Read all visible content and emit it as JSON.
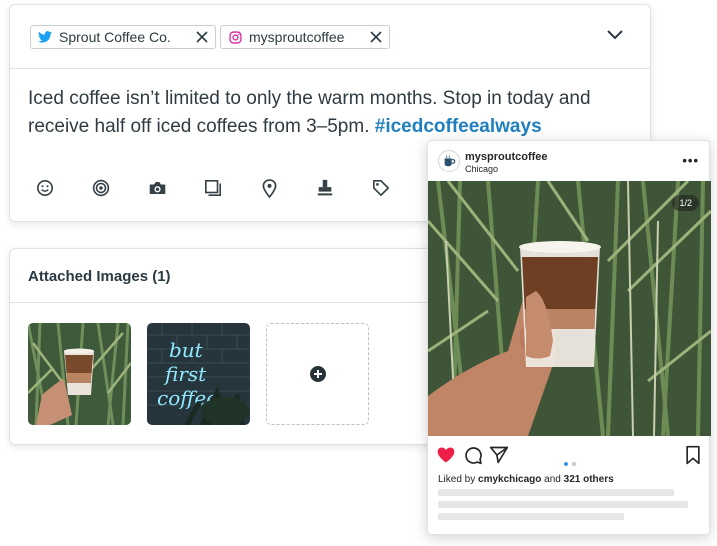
{
  "composer": {
    "profiles": [
      {
        "network": "twitter",
        "name": "Sprout Coffee Co."
      },
      {
        "network": "instagram",
        "name": "mysproutcoffee"
      }
    ],
    "message_text": "Iced coffee isn’t limited to only the warm months. Stop in today and receive half off iced coffees from 3–5pm. ",
    "hashtag": "#icedcoffeealways",
    "tools": [
      "emoji-icon",
      "target-icon",
      "camera-icon",
      "gallery-icon",
      "location-icon",
      "stamp-icon",
      "tag-icon"
    ]
  },
  "attached_images": {
    "title": "Attached Images (1)",
    "neon_sign_text": "but first coffee"
  },
  "instagram_preview": {
    "username": "mysproutcoffee",
    "location": "Chicago",
    "image_counter": "1/2",
    "liked_by_prefix": "Liked by ",
    "liked_by_user": "cmykchicago",
    "liked_by_and": " and ",
    "liked_by_count": "321 others"
  },
  "colors": {
    "hashtag": "#1f7fbf",
    "twitter": "#1da1f2",
    "instagram": "#d6249f",
    "like_heart": "#ed1f46",
    "carousel_dot_active": "#3897f0"
  }
}
